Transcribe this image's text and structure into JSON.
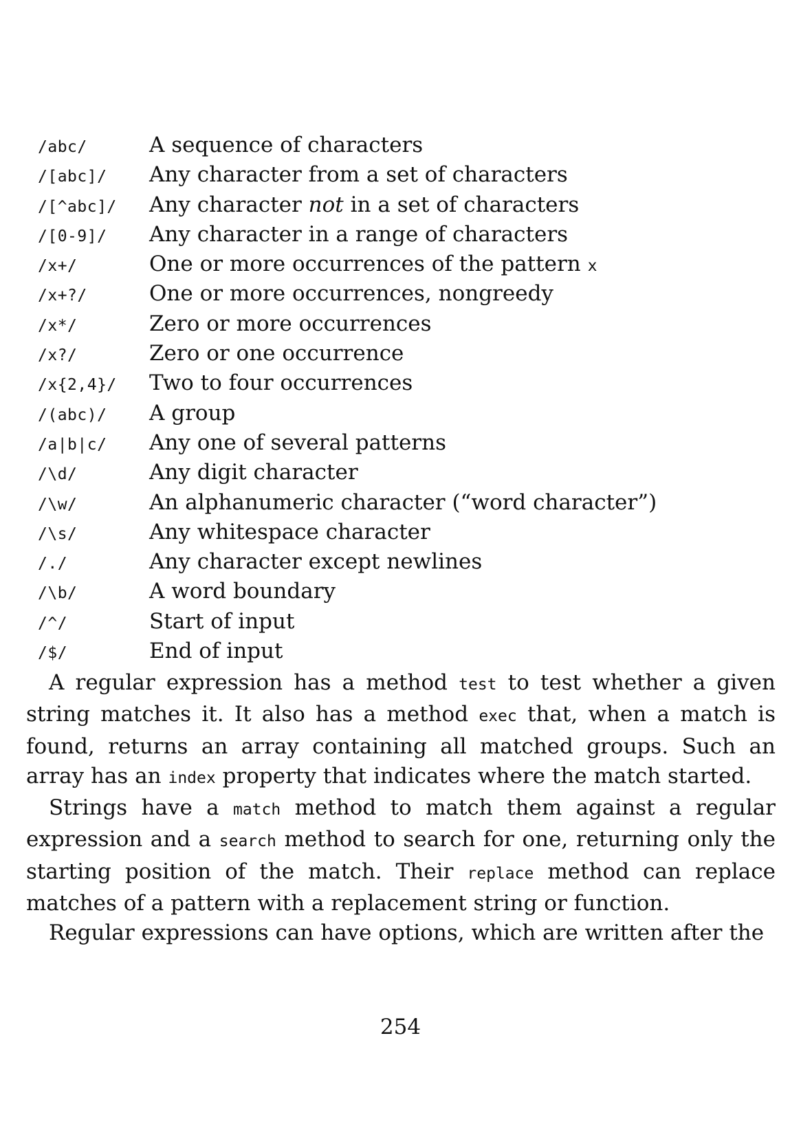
{
  "regex_table": [
    {
      "pattern": "/abc/",
      "desc": "A sequence of characters"
    },
    {
      "pattern": "/[abc]/",
      "desc": "Any character from a set of characters"
    },
    {
      "pattern": "/[^abc]/",
      "desc_before": "Any character ",
      "desc_em": "not",
      "desc_after": " in a set of characters"
    },
    {
      "pattern": "/[0-9]/",
      "desc": "Any character in a range of characters"
    },
    {
      "pattern": "/x+/",
      "desc": "One or more occurrences of the pattern ",
      "desc_code": "x"
    },
    {
      "pattern": "/x+?/",
      "desc": "One or more occurrences, nongreedy"
    },
    {
      "pattern": "/x*/",
      "desc": "Zero or more occurrences"
    },
    {
      "pattern": "/x?/",
      "desc": "Zero or one occurrence"
    },
    {
      "pattern": "/x{2,4}/",
      "desc": "Two to four occurrences"
    },
    {
      "pattern": "/(abc)/",
      "desc": "A group"
    },
    {
      "pattern": "/a|b|c/",
      "desc": "Any one of several patterns"
    },
    {
      "pattern": "/\\d/",
      "desc": "Any digit character"
    },
    {
      "pattern": "/\\w/",
      "desc": "An alphanumeric character (“word character”)"
    },
    {
      "pattern": "/\\s/",
      "desc": "Any whitespace character"
    },
    {
      "pattern": "/./",
      "desc": "Any character except newlines"
    },
    {
      "pattern": "/\\b/",
      "desc": "A word boundary"
    },
    {
      "pattern": "/^/",
      "desc": "Start of input"
    },
    {
      "pattern": "/$/",
      "desc": "End of input"
    }
  ],
  "paragraphs": {
    "p1": {
      "t1": "A regular expression has a method ",
      "c1": "test",
      "t2": " to test whether a given string matches it. It also has a method ",
      "c2": "exec",
      "t3": " that, when a match is found, returns an array containing all matched groups. Such an array has an ",
      "c3": "index",
      "t4": " property that indicates where the match started."
    },
    "p2": {
      "t1": "Strings have a ",
      "c1": "match",
      "t2": " method to match them against a regular expression and a ",
      "c2": "search",
      "t3": " method to search for one, returning only the starting position of the match. Their ",
      "c3": "replace",
      "t4": " method can replace matches of a pattern with a replacement string or function."
    },
    "p3": {
      "t1": "Regular expressions can have options, which are written after the"
    }
  },
  "page_number": "254"
}
